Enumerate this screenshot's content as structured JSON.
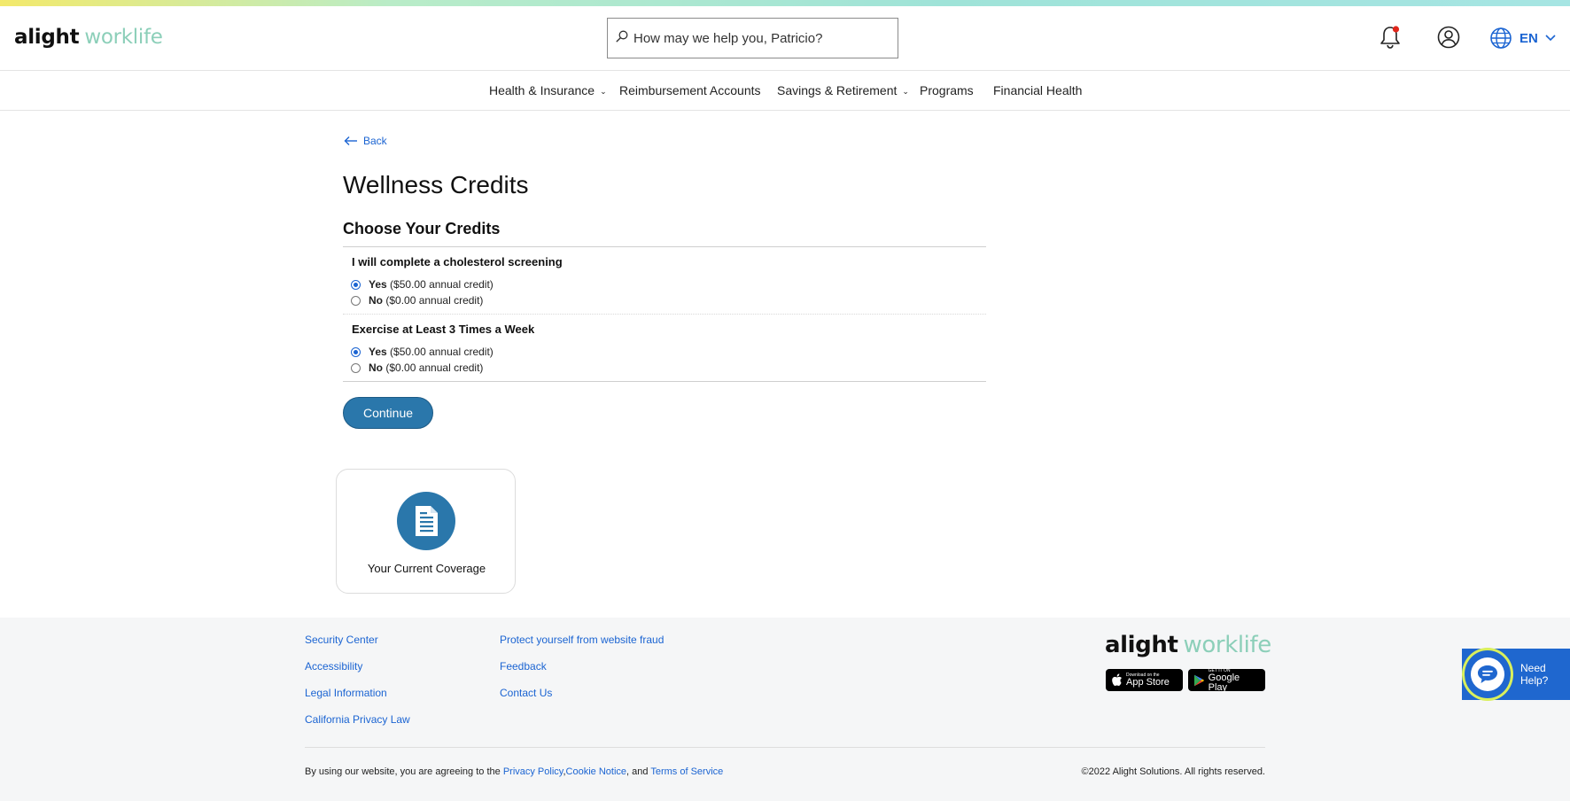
{
  "brand": {
    "part1": "alight",
    "part2": "worklife"
  },
  "search": {
    "placeholder": "How may we help you, Patricio?"
  },
  "header": {
    "language": "EN"
  },
  "nav": {
    "items": [
      {
        "label": "Health & Insurance",
        "has_dropdown": true
      },
      {
        "label": "Reimbursement Accounts",
        "has_dropdown": false
      },
      {
        "label": "Savings & Retirement",
        "has_dropdown": true
      },
      {
        "label": "Programs",
        "has_dropdown": false
      },
      {
        "label": "Financial Health",
        "has_dropdown": false
      }
    ]
  },
  "main": {
    "back_label": "Back",
    "title": "Wellness Credits",
    "section_title": "Choose Your Credits",
    "questions": [
      {
        "label": "I will complete a cholesterol screening",
        "options": [
          {
            "answer": "Yes",
            "detail": "($50.00 annual credit)",
            "selected": true
          },
          {
            "answer": "No",
            "detail": "($0.00 annual credit)",
            "selected": false
          }
        ]
      },
      {
        "label": "Exercise at Least 3 Times a Week",
        "options": [
          {
            "answer": "Yes",
            "detail": "($50.00 annual credit)",
            "selected": true
          },
          {
            "answer": "No",
            "detail": "($0.00 annual credit)",
            "selected": false
          }
        ]
      }
    ],
    "continue_label": "Continue",
    "coverage_card_label": "Your Current Coverage"
  },
  "footer": {
    "col1": [
      "Security Center",
      "Accessibility",
      "Legal Information",
      "California Privacy Law"
    ],
    "col2": [
      "Protect yourself from website fraud",
      "Feedback",
      "Contact Us"
    ],
    "app_store": {
      "small": "Download on the",
      "big": "App Store"
    },
    "google_play": {
      "small": "GET IT ON",
      "big": "Google Play"
    },
    "legal_prefix": "By using our website, you are agreeing to the",
    "privacy_policy": "Privacy Policy",
    "cookie_notice": "Cookie Notice",
    "legal_and": ", and",
    "terms": "Terms of Service",
    "copyright": "©2022 Alight Solutions. All rights reserved."
  },
  "help": {
    "line1": "Need",
    "line2": "Help?"
  },
  "colors": {
    "accent_blue": "#1b64d2",
    "button_blue": "#2a77ab",
    "brand_green": "#8ccfb9",
    "help_ring": "#d9ef5c"
  }
}
